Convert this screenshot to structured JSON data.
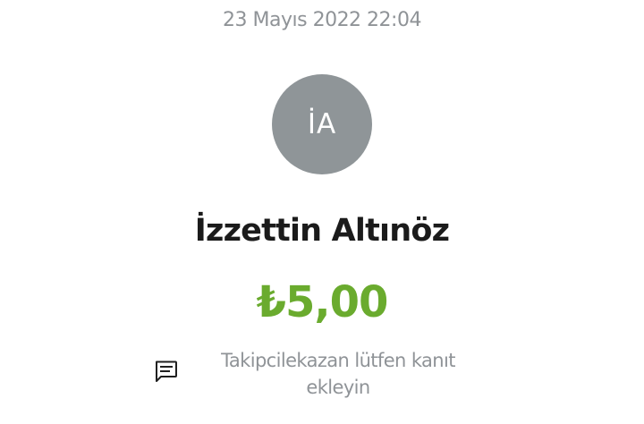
{
  "transaction": {
    "date": "23 Mayıs 2022 22:04",
    "avatar_initials": "İA",
    "name": "İzzettin Altınöz",
    "amount": "₺5,00",
    "note": "Takipcilekazan  lütfen kanıt ekleyin"
  },
  "icons": {
    "note": "message-icon"
  },
  "colors": {
    "amount": "#6aab2e",
    "avatar_bg": "#8f9598",
    "muted_text": "#8f9397",
    "name_text": "#1b1b1b"
  }
}
